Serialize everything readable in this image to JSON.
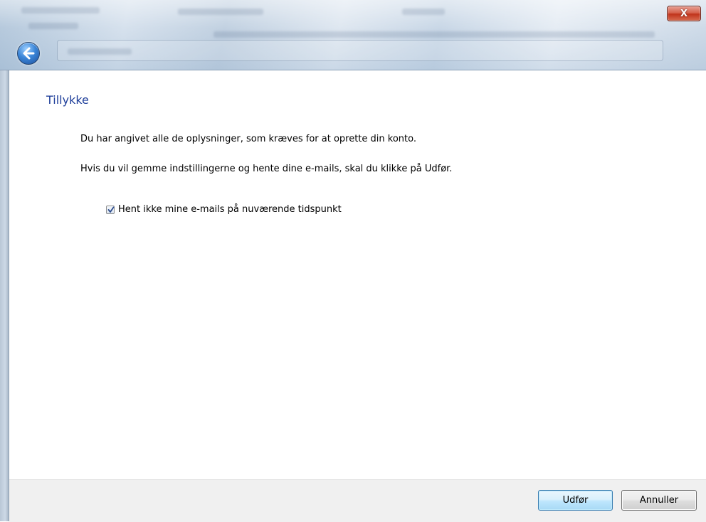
{
  "window": {
    "close_glyph": "X"
  },
  "wizard": {
    "title": "Tillykke",
    "paragraph_1": "Du har angivet alle de oplysninger, som kræves for at oprette din konto.",
    "paragraph_2": "Hvis du vil gemme indstillingerne og hente dine e-mails, skal du klikke på Udfør.",
    "checkbox_label": "Hent ikke mine e-mails på nuværende tidspunkt",
    "checkbox_checked": true
  },
  "footer": {
    "finish_label": "Udfør",
    "cancel_label": "Annuller"
  },
  "icons": {
    "back": "back-arrow-icon",
    "close": "close-icon",
    "check": "checkmark-icon"
  },
  "colors": {
    "heading": "#1e3e9a",
    "close_button": "#c1341c",
    "primary_button_border": "#3c7fb1"
  }
}
